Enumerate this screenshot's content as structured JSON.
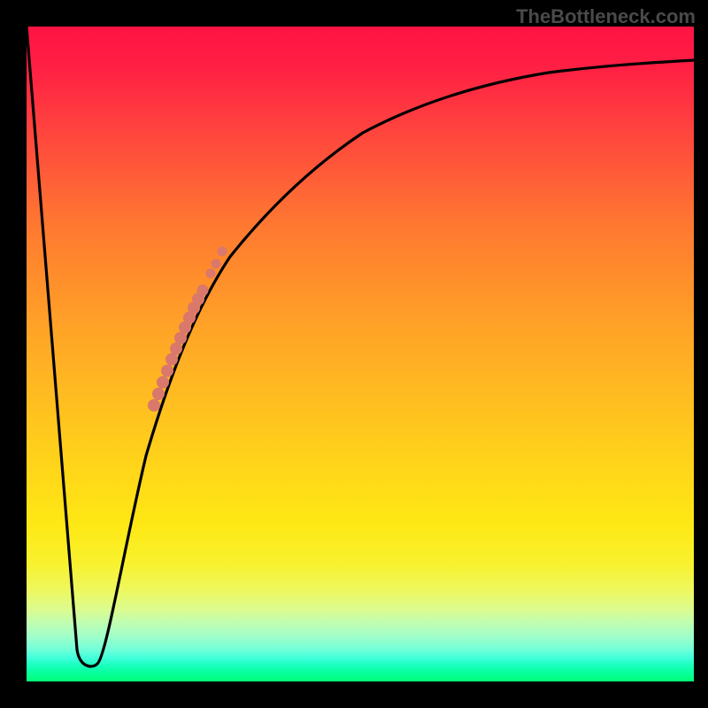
{
  "watermark": "TheBottleneck.com",
  "chart_data": {
    "type": "line",
    "title": "",
    "xlabel": "",
    "ylabel": "",
    "xlim": [
      0,
      100
    ],
    "ylim": [
      0,
      100
    ],
    "grid": false,
    "legend": false,
    "background": "gradient red-to-green vertical",
    "series": [
      {
        "name": "bottleneck-curve",
        "color": "#000000",
        "x": [
          0,
          2,
          4,
          6,
          8,
          9,
          10,
          11,
          12,
          14,
          16,
          18,
          20,
          22,
          24,
          26,
          28,
          30,
          33,
          36,
          40,
          45,
          50,
          56,
          63,
          72,
          82,
          92,
          100
        ],
        "y": [
          100,
          78,
          56,
          34,
          12,
          3,
          2,
          2,
          8,
          20,
          30,
          38,
          45,
          51,
          56,
          60,
          64,
          67,
          71,
          75,
          78,
          81,
          84,
          86,
          88,
          90,
          91.5,
          92.5,
          93
        ]
      },
      {
        "name": "highlight-dots",
        "type": "scatter",
        "color": "#d9786b",
        "x": [
          19.5,
          20,
          20.5,
          21,
          21.5,
          22,
          22.5,
          23,
          23.5,
          24,
          24.5,
          25,
          25.5,
          26,
          27,
          28
        ],
        "y": [
          43,
          45,
          47,
          49,
          50.5,
          52,
          53.5,
          55,
          56,
          57,
          58,
          59,
          59.5,
          60,
          62.5,
          64.5
        ]
      }
    ]
  },
  "colors": {
    "frame": "#000000",
    "curve": "#000000",
    "dots": "#d9786b",
    "gradient_top": "#ff1343",
    "gradient_bottom": "#00ff77"
  }
}
